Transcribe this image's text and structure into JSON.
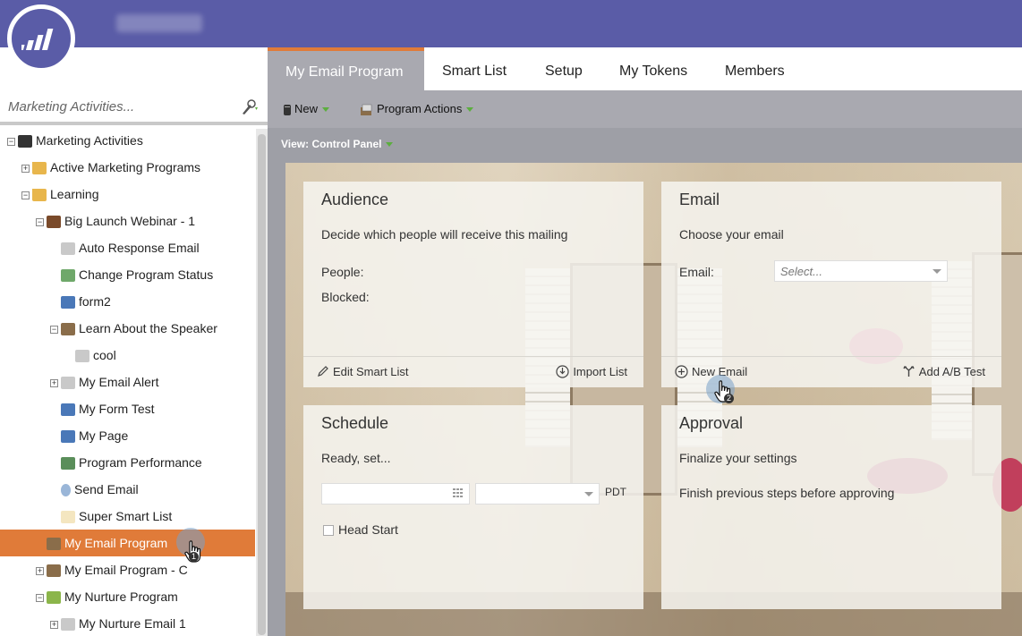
{
  "header": {
    "logo_icon": "marketo-logo-icon",
    "brand_color": "#5a5ca7",
    "accent_color": "#e07b39"
  },
  "left_panel": {
    "search_placeholder": "Marketing Activities...",
    "tree": [
      {
        "label": "Marketing Activities",
        "level": 0,
        "expander": "minus",
        "icon": "database-icon"
      },
      {
        "label": "Active Marketing Programs",
        "level": 1,
        "expander": "plus",
        "icon": "folder-icon"
      },
      {
        "label": "Learning",
        "level": 1,
        "expander": "minus",
        "icon": "folder-icon"
      },
      {
        "label": "Big Launch Webinar - 1",
        "level": 2,
        "expander": "minus",
        "icon": "event-program-icon"
      },
      {
        "label": "Auto Response Email",
        "level": 3,
        "expander": "",
        "icon": "email-icon"
      },
      {
        "label": "Change Program Status",
        "level": 3,
        "expander": "",
        "icon": "smart-campaign-icon"
      },
      {
        "label": "form2",
        "level": 3,
        "expander": "",
        "icon": "form-icon"
      },
      {
        "label": "Learn About the Speaker",
        "level": 3,
        "expander": "minus",
        "icon": "email-program-icon"
      },
      {
        "label": "cool",
        "level": 4,
        "expander": "",
        "icon": "email-icon"
      },
      {
        "label": "My Email Alert",
        "level": 3,
        "expander": "plus",
        "icon": "email-icon"
      },
      {
        "label": "My Form Test",
        "level": 3,
        "expander": "",
        "icon": "form-icon"
      },
      {
        "label": "My Page",
        "level": 3,
        "expander": "",
        "icon": "landing-page-icon"
      },
      {
        "label": "Program Performance",
        "level": 3,
        "expander": "",
        "icon": "report-icon"
      },
      {
        "label": "Send Email",
        "level": 3,
        "expander": "",
        "icon": "lightbulb-icon"
      },
      {
        "label": "Super Smart List",
        "level": 3,
        "expander": "",
        "icon": "smart-list-icon"
      },
      {
        "label": "My Email Program",
        "level": 2,
        "expander": "",
        "icon": "email-program-icon",
        "selected": true
      },
      {
        "label": "My Email Program - C",
        "level": 2,
        "expander": "plus",
        "icon": "email-program-icon"
      },
      {
        "label": "My Nurture Program",
        "level": 2,
        "expander": "minus",
        "icon": "nurture-program-icon"
      },
      {
        "label": "My Nurture Email 1",
        "level": 3,
        "expander": "plus",
        "icon": "email-icon"
      }
    ]
  },
  "tabs": [
    {
      "label": "My Email Program",
      "active": true
    },
    {
      "label": "Smart List"
    },
    {
      "label": "Setup"
    },
    {
      "label": "My Tokens"
    },
    {
      "label": "Members"
    }
  ],
  "toolbar": {
    "new_label": "New",
    "program_actions_label": "Program Actions"
  },
  "view": {
    "label": "View: Control Panel"
  },
  "cards": {
    "audience": {
      "title": "Audience",
      "desc": "Decide which people will receive this mailing",
      "people_label": "People:",
      "blocked_label": "Blocked:",
      "edit_smart_list": "Edit Smart List",
      "import_list": "Import List"
    },
    "email": {
      "title": "Email",
      "desc": "Choose your email",
      "email_label": "Email:",
      "select_placeholder": "Select...",
      "new_email": "New Email",
      "add_ab_test": "Add A/B Test"
    },
    "schedule": {
      "title": "Schedule",
      "desc": "Ready, set...",
      "tz": "PDT",
      "head_start": "Head Start"
    },
    "approval": {
      "title": "Approval",
      "desc": "Finalize your settings",
      "note": "Finish previous steps before approving"
    }
  },
  "cursors": [
    {
      "step": "1"
    },
    {
      "step": "2"
    }
  ]
}
